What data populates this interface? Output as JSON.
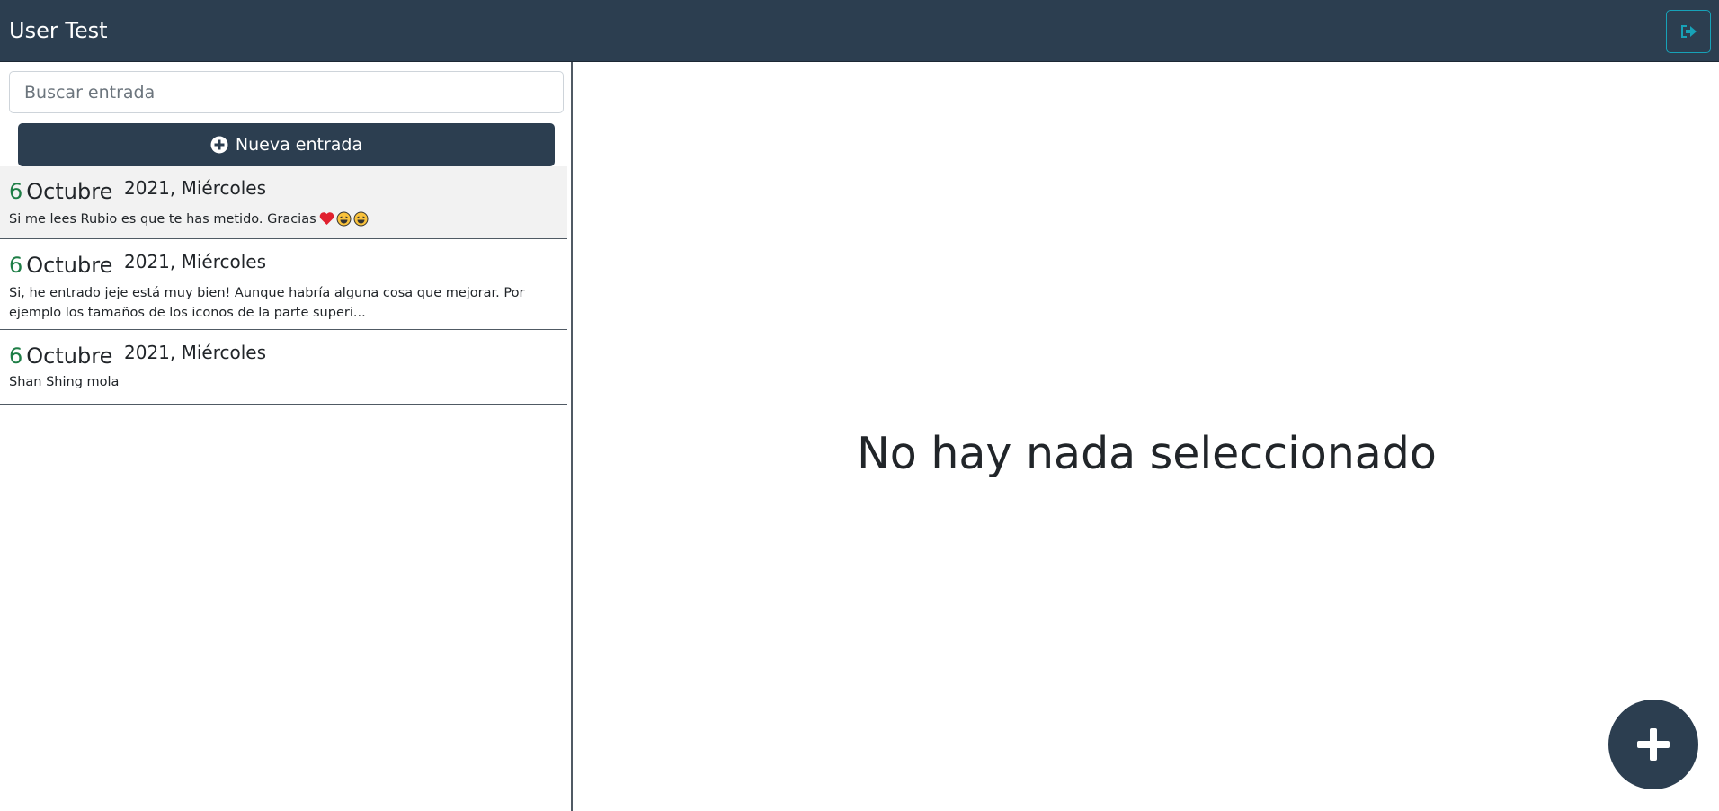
{
  "header": {
    "title": "User Test",
    "logout_icon": "sign-out-icon"
  },
  "sidebar": {
    "search": {
      "placeholder": "Buscar entrada",
      "value": ""
    },
    "new_entry_label": "Nueva entrada",
    "entries": [
      {
        "day": "6",
        "month": "Octubre",
        "year_weekday": "2021, Miércoles",
        "text": "Si me lees Rubio es que te has metido. Gracias",
        "selected": true
      },
      {
        "day": "6",
        "month": "Octubre",
        "year_weekday": "2021, Miércoles",
        "text": "Si, he entrado jeje está muy bien! Aunque habría alguna cosa que mejorar. Por ejemplo los tamaños de los iconos de la parte superi...",
        "selected": false
      },
      {
        "day": "6",
        "month": "Octubre",
        "year_weekday": "2021, Miércoles",
        "text": "Shan Shing mola",
        "selected": false
      }
    ]
  },
  "main": {
    "empty_message": "No hay nada seleccionado"
  },
  "colors": {
    "primary": "#2c3e50",
    "accent": "#17a2b8",
    "day": "#1e7e46"
  }
}
